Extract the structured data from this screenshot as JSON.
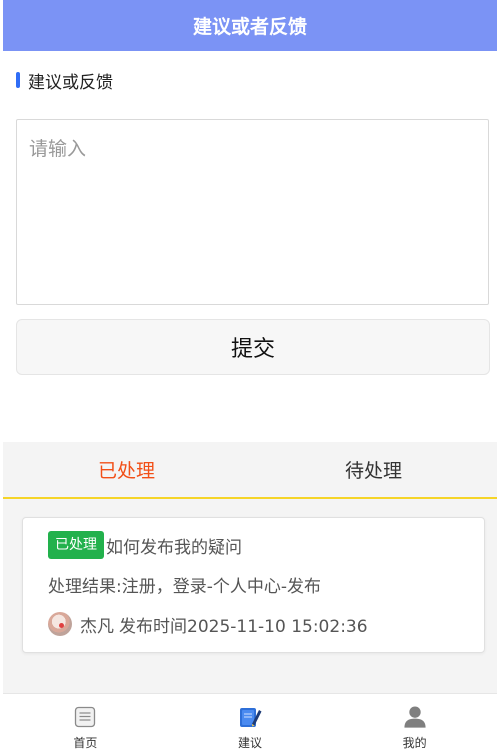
{
  "header": {
    "title": "建议或者反馈"
  },
  "form": {
    "section_title": "建议或反馈",
    "textarea_placeholder": "请输入",
    "submit_label": "提交"
  },
  "tabs": [
    {
      "label": "已处理",
      "active": true
    },
    {
      "label": "待处理",
      "active": false
    }
  ],
  "feedback_items": [
    {
      "status": "已处理",
      "title": "如何发布我的疑问",
      "result": "处理结果:注册，登录-个人中心-发布",
      "author": "杰凡",
      "publish_time": "发布时间2025-11-10 15:02:36"
    }
  ],
  "bottom_nav": [
    {
      "label": "首页",
      "icon": "home-doc-icon"
    },
    {
      "label": "建议",
      "icon": "notebook-pen-icon"
    },
    {
      "label": "我的",
      "icon": "user-icon"
    }
  ],
  "colors": {
    "header_bg": "#7b93f5",
    "accent_bar": "#2f6df6",
    "active_tab": "#f24f17",
    "tab_underline": "#f5d428",
    "status_badge": "#22b14c"
  }
}
